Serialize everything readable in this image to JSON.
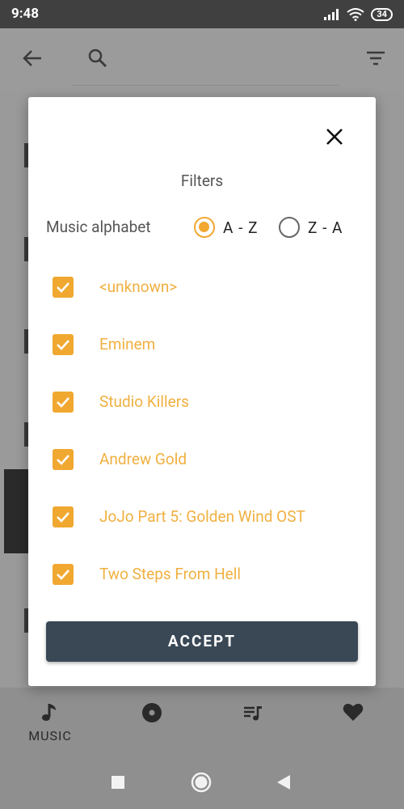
{
  "status_bar": {
    "time": "9:48",
    "battery": "34"
  },
  "dialog": {
    "title": "Filters",
    "sort": {
      "label": "Music alphabet",
      "options": [
        {
          "label": "A - Z",
          "selected": true
        },
        {
          "label": "Z - A",
          "selected": false
        }
      ]
    },
    "artists": [
      {
        "name": "<unknown>",
        "checked": true
      },
      {
        "name": "Eminem",
        "checked": true
      },
      {
        "name": "Studio Killers",
        "checked": true
      },
      {
        "name": "Andrew Gold",
        "checked": true
      },
      {
        "name": "JoJo Part 5: Golden Wind OST",
        "checked": true
      },
      {
        "name": "Two Steps From Hell",
        "checked": true
      }
    ],
    "accept_label": "ACCEPT"
  },
  "bottom_nav": {
    "items": [
      {
        "label": "MUSIC",
        "icon": "music-note-icon"
      },
      {
        "label": "",
        "icon": "album-icon"
      },
      {
        "label": "",
        "icon": "playlist-icon"
      },
      {
        "label": "",
        "icon": "heart-icon"
      }
    ]
  },
  "colors": {
    "accent": "#f0a830",
    "button": "#3a4856",
    "scrim": "#9a9a9a"
  }
}
